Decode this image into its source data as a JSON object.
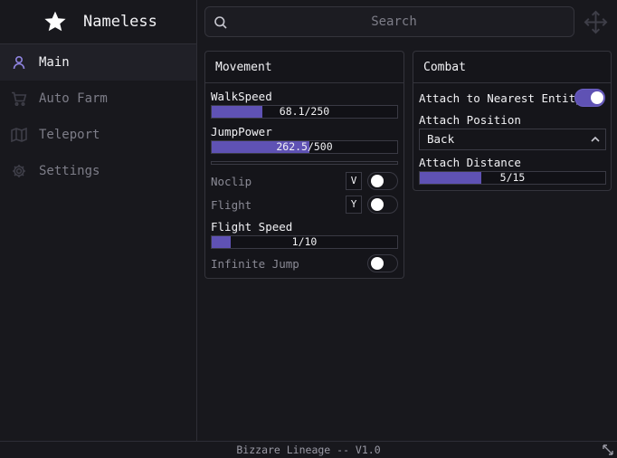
{
  "brand": {
    "title": "Nameless",
    "icon": "star-icon"
  },
  "sidebar": {
    "items": [
      {
        "label": "Main",
        "icon": "user-icon",
        "active": true
      },
      {
        "label": "Auto Farm",
        "icon": "cart-icon",
        "active": false
      },
      {
        "label": "Teleport",
        "icon": "map-icon",
        "active": false
      },
      {
        "label": "Settings",
        "icon": "gear-icon",
        "active": false
      }
    ]
  },
  "search": {
    "placeholder": "Search",
    "value": ""
  },
  "movement": {
    "title": "Movement",
    "walkspeed": {
      "label": "WalkSpeed",
      "value_text": "68.1/250",
      "fraction": 0.2724
    },
    "jumppower": {
      "label": "JumpPower",
      "value_text": "262.5/500",
      "fraction": 0.525
    },
    "noclip": {
      "label": "Noclip",
      "key": "V",
      "on": false
    },
    "flight": {
      "label": "Flight",
      "key": "Y",
      "on": false
    },
    "flightspeed": {
      "label": "Flight Speed",
      "value_text": "1/10",
      "fraction": 0.1
    },
    "infinitejump": {
      "label": "Infinite Jump",
      "on": false
    }
  },
  "combat": {
    "title": "Combat",
    "attach": {
      "label": "Attach to Nearest Entity",
      "on": true
    },
    "position": {
      "label": "Attach Position",
      "selected": "Back"
    },
    "distance": {
      "label": "Attach Distance",
      "value_text": "5/15",
      "fraction": 0.3333
    }
  },
  "footer": {
    "text": "Bizzare Lineage -- V1.0"
  },
  "colors": {
    "accent": "#5f52b4",
    "background": "#18181d",
    "panel": "#15151a",
    "border": "#34343c"
  }
}
